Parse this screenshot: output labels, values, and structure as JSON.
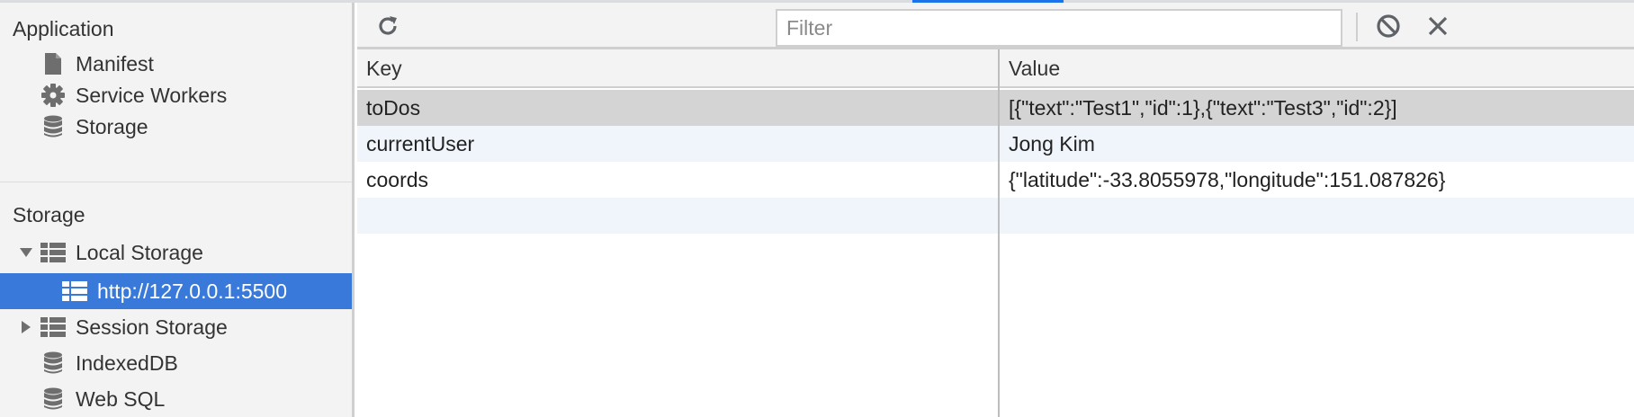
{
  "sidebar": {
    "application": {
      "title": "Application",
      "items": [
        {
          "label": "Manifest",
          "icon": "file-icon"
        },
        {
          "label": "Service Workers",
          "icon": "gear-icon"
        },
        {
          "label": "Storage",
          "icon": "database-icon"
        }
      ]
    },
    "storage": {
      "title": "Storage",
      "items": [
        {
          "label": "Local Storage",
          "icon": "grid-icon",
          "expanded": true
        },
        {
          "label": "http://127.0.0.1:5500",
          "icon": "grid-icon",
          "selected": true
        },
        {
          "label": "Session Storage",
          "icon": "grid-icon",
          "expanded": false
        },
        {
          "label": "IndexedDB",
          "icon": "database-icon"
        },
        {
          "label": "Web SQL",
          "icon": "database-icon"
        }
      ]
    }
  },
  "toolbar": {
    "filter_placeholder": "Filter",
    "filter_value": ""
  },
  "table": {
    "columns": [
      "Key",
      "Value"
    ],
    "rows": [
      {
        "key": "toDos",
        "value": "[{\"text\":\"Test1\",\"id\":1},{\"text\":\"Test3\",\"id\":2}]",
        "selected": true
      },
      {
        "key": "currentUser",
        "value": "Jong Kim"
      },
      {
        "key": "coords",
        "value": "{\"latitude\":-33.8055978,\"longitude\":151.087826}"
      }
    ]
  },
  "colors": {
    "selection": "#3879d9",
    "row_selected": "#d4d4d4",
    "row_alt": "#f0f5fb"
  }
}
